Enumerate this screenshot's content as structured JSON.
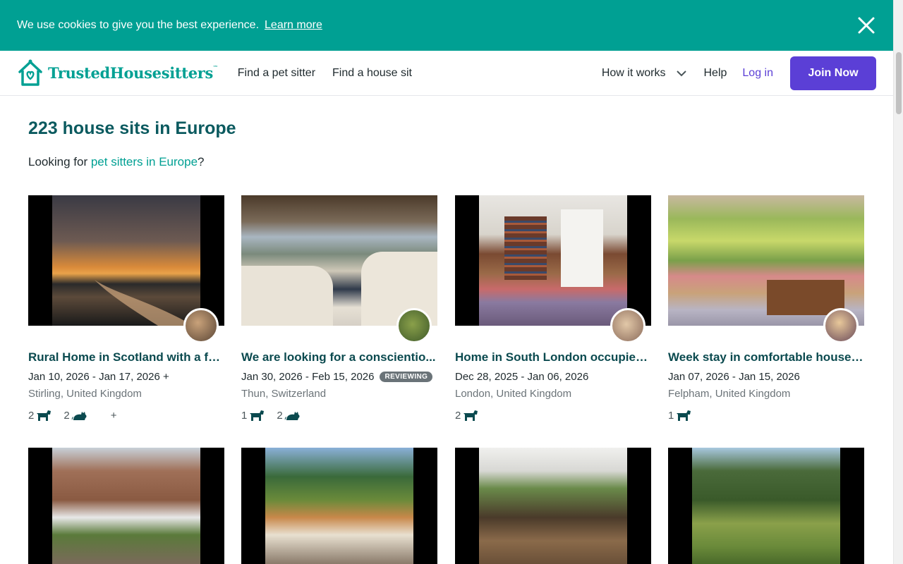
{
  "cookie": {
    "message": "We use cookies to give you the best experience.",
    "link": "Learn more"
  },
  "header": {
    "brand": "TrustedHousesitters",
    "nav": [
      "Find a pet sitter",
      "Find a house sit"
    ],
    "how_it_works": "How it works",
    "help": "Help",
    "login": "Log in",
    "join": "Join Now"
  },
  "colors": {
    "brand_teal": "#00a093",
    "title_teal": "#0b5a5f",
    "purple": "#5b3fd6"
  },
  "main": {
    "title": "223 house sits in Europe",
    "subtitle_prefix": "Looking for ",
    "subtitle_link": "pet sitters in Europe",
    "subtitle_suffix": "?"
  },
  "listings": [
    {
      "title": "Rural Home in Scotland with a fe...",
      "dates": "Jan 10, 2026 - Jan 17, 2026 +",
      "badge": "",
      "location": "Stirling, United Kingdom",
      "dogs": "2",
      "cats": "2",
      "more": "+"
    },
    {
      "title": "We are looking for a conscientio...",
      "dates": "Jan 30, 2026 - Feb 15, 2026",
      "badge": "REVIEWING",
      "location": "Thun, Switzerland",
      "dogs": "1",
      "cats": "2",
      "more": ""
    },
    {
      "title": "Home in South London occupied ...",
      "dates": "Dec 28, 2025 - Jan 06, 2026",
      "badge": "",
      "location": "London, United Kingdom",
      "dogs": "2",
      "cats": "",
      "more": ""
    },
    {
      "title": "Week stay in comfortable house ...",
      "dates": "Jan 07, 2026 - Jan 15, 2026",
      "badge": "",
      "location": "Felpham, United Kingdom",
      "dogs": "1",
      "cats": "",
      "more": ""
    }
  ]
}
